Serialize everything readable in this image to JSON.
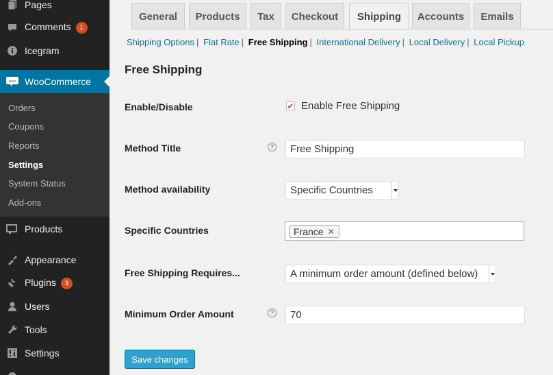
{
  "sidebar": {
    "items": [
      {
        "label": "Pages",
        "icon": "pages-icon"
      },
      {
        "label": "Comments",
        "icon": "comments-icon",
        "badge": "1"
      },
      {
        "label": "Icegram",
        "icon": "info-icon"
      },
      {
        "label": "WooCommerce",
        "icon": "woo-icon"
      },
      {
        "label": "Products",
        "icon": "products-icon"
      },
      {
        "label": "Appearance",
        "icon": "appearance-icon"
      },
      {
        "label": "Plugins",
        "icon": "plugins-icon",
        "badge": "3"
      },
      {
        "label": "Users",
        "icon": "users-icon"
      },
      {
        "label": "Tools",
        "icon": "tools-icon"
      },
      {
        "label": "Settings",
        "icon": "settings-icon"
      }
    ],
    "submenu": [
      "Orders",
      "Coupons",
      "Reports",
      "Settings",
      "System Status",
      "Add-ons"
    ],
    "colors": {
      "background": "#222222",
      "current": "#0074a2",
      "submenu_bg": "#333333"
    }
  },
  "tabs": [
    "General",
    "Products",
    "Tax",
    "Checkout",
    "Shipping",
    "Accounts",
    "Emails"
  ],
  "active_tab": "Shipping",
  "subnav": [
    "Shipping Options",
    "Flat Rate",
    "Free Shipping",
    "International Delivery",
    "Local Delivery",
    "Local Pickup"
  ],
  "current_subnav": "Free Shipping",
  "page_title": "Free Shipping",
  "form": {
    "enable_label": "Enable/Disable",
    "enable_checkbox_label": "Enable Free Shipping",
    "enable_checked": true,
    "method_title_label": "Method Title",
    "method_title_value": "Free Shipping",
    "availability_label": "Method availability",
    "availability_value": "Specific Countries",
    "countries_label": "Specific Countries",
    "countries": [
      "France"
    ],
    "requires_label": "Free Shipping Requires...",
    "requires_value": "A minimum order amount (defined below)",
    "min_amount_label": "Minimum Order Amount",
    "min_amount_value": "70",
    "help_glyph": "?"
  },
  "save_label": "Save changes",
  "accent_color": "#2ea2cc"
}
